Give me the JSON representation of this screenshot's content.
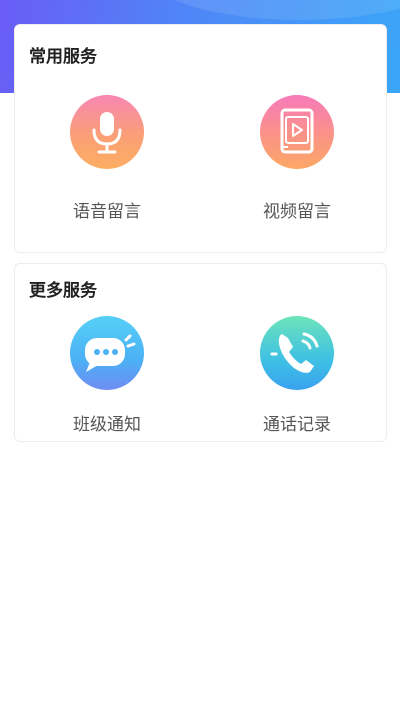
{
  "colors": {
    "header_gradient_start": "#6a5cf6",
    "header_gradient_end": "#3aa6f8",
    "card_border": "#ececec",
    "title_text": "#222222",
    "label_text": "#555555"
  },
  "common_services": {
    "title": "常用服务",
    "items": [
      {
        "label": "语音留言",
        "icon": "microphone-icon"
      },
      {
        "label": "视频留言",
        "icon": "video-play-icon"
      }
    ]
  },
  "more_services": {
    "title": "更多服务",
    "items": [
      {
        "label": "班级通知",
        "icon": "chat-bubble-icon"
      },
      {
        "label": "通话记录",
        "icon": "phone-icon"
      }
    ]
  }
}
